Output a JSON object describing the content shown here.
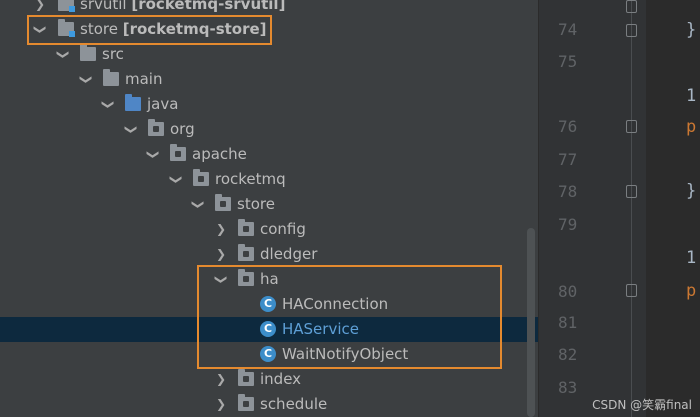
{
  "tree": {
    "rows": [
      {
        "label": "srvutil",
        "qualifier": "[rocketmq-srvutil]"
      },
      {
        "label": "store",
        "qualifier": "[rocketmq-store]"
      },
      {
        "label": "src"
      },
      {
        "label": "main"
      },
      {
        "label": "java"
      },
      {
        "label": "org"
      },
      {
        "label": "apache"
      },
      {
        "label": "rocketmq"
      },
      {
        "label": "store"
      },
      {
        "label": "config"
      },
      {
        "label": "dledger"
      },
      {
        "label": "ha"
      },
      {
        "label": "HAConnection",
        "icon_letter": "C"
      },
      {
        "label": "HAService",
        "icon_letter": "C"
      },
      {
        "label": "WaitNotifyObject",
        "icon_letter": "C"
      },
      {
        "label": "index"
      },
      {
        "label": "schedule"
      }
    ],
    "selected_row": "HAService"
  },
  "gutter": {
    "line_numbers": [
      "74",
      "75",
      "76",
      "77",
      "78",
      "79",
      "80",
      "81",
      "82",
      "83"
    ]
  },
  "editor": {
    "lines": [
      {
        "text": "}"
      },
      {
        "text": "1"
      },
      {
        "text": "p"
      },
      {
        "text": "}"
      },
      {
        "text": "1"
      },
      {
        "text": "p"
      }
    ]
  },
  "watermark": "CSDN @笑霸final",
  "colors": {
    "highlight_box": "#e58a2f",
    "selected_row": "#0d293e",
    "class_icon": "#3c8dc9"
  }
}
